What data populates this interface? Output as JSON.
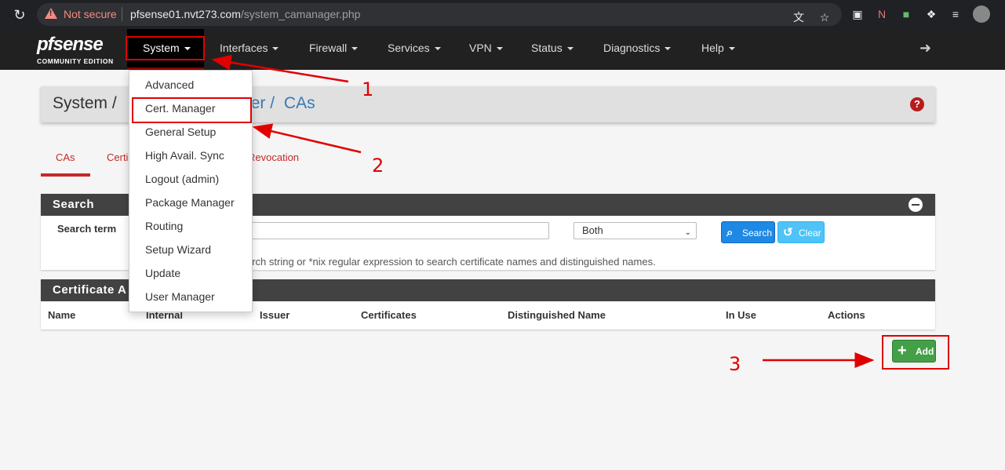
{
  "browser": {
    "security_label": "Not secure",
    "url_host": "pfsense01.nvt273.com",
    "url_path": "/system_camanager.php"
  },
  "navbar": {
    "logo_text": "pfsense",
    "logo_subtitle": "COMMUNITY EDITION",
    "items": [
      {
        "label": "System"
      },
      {
        "label": "Interfaces"
      },
      {
        "label": "Firewall"
      },
      {
        "label": "Services"
      },
      {
        "label": "VPN"
      },
      {
        "label": "Status"
      },
      {
        "label": "Diagnostics"
      },
      {
        "label": "Help"
      }
    ]
  },
  "system_menu": {
    "items": [
      {
        "label": "Advanced"
      },
      {
        "label": "Cert. Manager"
      },
      {
        "label": "General Setup"
      },
      {
        "label": "High Avail. Sync"
      },
      {
        "label": "Logout (admin)"
      },
      {
        "label": "Package Manager"
      },
      {
        "label": "Routing"
      },
      {
        "label": "Setup Wizard"
      },
      {
        "label": "Update"
      },
      {
        "label": "User Manager"
      }
    ]
  },
  "breadcrumb": {
    "part1": "System /",
    "part2": "ager /",
    "part3": "CAs"
  },
  "tabs": {
    "cas": "CAs",
    "certificates_partial": "Certi",
    "revocation_partial": "Revocation"
  },
  "search_panel": {
    "title": "Search",
    "term_label": "Search term",
    "scope_value": "Both",
    "search_button": "Search",
    "clear_button": "Clear",
    "help_text": "arch string or *nix regular expression to search certificate names and distinguished names."
  },
  "ca_panel": {
    "title_partial": "Certificate A",
    "columns": [
      "Name",
      "Internal",
      "Issuer",
      "Certificates",
      "Distinguished Name",
      "In Use",
      "Actions"
    ],
    "add_button": "Add"
  },
  "annotations": {
    "step1": "1",
    "step2": "2",
    "step3": "3",
    "color": "#e00000"
  }
}
